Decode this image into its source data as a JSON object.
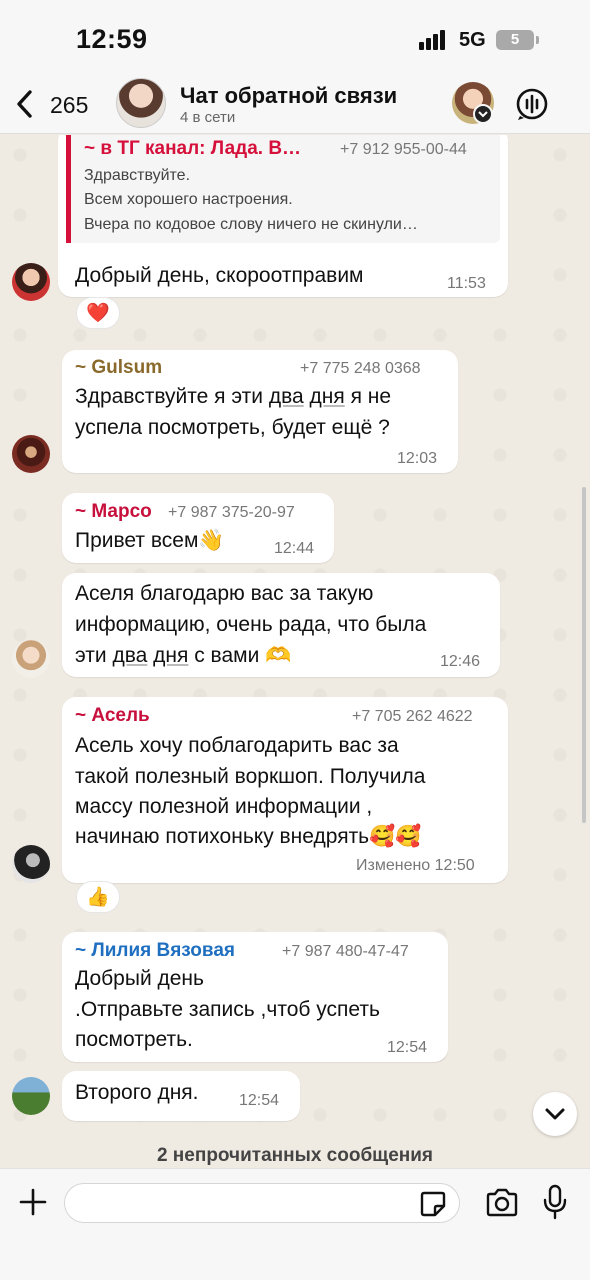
{
  "status": {
    "time": "12:59",
    "network": "5G",
    "battery": "5"
  },
  "header": {
    "back_count": "265",
    "title": "Чат обратной связи",
    "subtitle": "4 в сети"
  },
  "quote": {
    "name": "~ в ТГ канал: Лада. В…",
    "phone": "+7 912 955-00-44",
    "lines": [
      "Здравствуйте.",
      "Всем хорошего настроения.",
      "Вчера по кодовое слову ничего не скинули…"
    ]
  },
  "messages": [
    {
      "text": "Добрый день, скороотправим",
      "time": "11:53",
      "reaction": "❤️"
    },
    {
      "sender": "~ Gulsum",
      "phone": "+7 775 248 0368",
      "lines": [
        "Здравствуйте я эти два дня я не",
        "успела посмотреть, будет ещё ?"
      ],
      "time": "12:03"
    },
    {
      "sender": "~ Марсо",
      "phone": "+7 987 375-20-97",
      "text": "Привет всем👋",
      "time": "12:44"
    },
    {
      "lines": [
        "Аселя благодарю вас за такую",
        "информацию, очень рада, что была",
        "эти два дня с вами 🫶"
      ],
      "time": "12:46"
    },
    {
      "sender": "~ Асель",
      "phone": "+7 705 262 4622",
      "lines": [
        "Асель  хочу поблагодарить вас за",
        "такой полезный воркшоп. Получила",
        "массу полезной информации ,",
        "начинаю потихоньку внедрять🥰🥰"
      ],
      "time": "Изменено 12:50",
      "reaction": "👍"
    },
    {
      "sender": "~ Лилия Вязовая",
      "phone": "+7 987 480-47-47",
      "lines": [
        "Добрый день",
        ".Отправьте запись ,чтоб успеть",
        "посмотреть."
      ],
      "time": "12:54"
    },
    {
      "text": "Второго дня.",
      "time": "12:54"
    }
  ],
  "unread_label": "2 непрочитанных сообщения",
  "colors": {
    "quote_accent": "#d5103b",
    "gulsum": "#8a6a2c",
    "marso": "#c8103c",
    "asel": "#c8103c",
    "liliya": "#1f6fc1"
  },
  "icons": [
    "back-chevron-icon",
    "call-waveform-icon",
    "plus-icon",
    "sticker-icon",
    "camera-icon",
    "mic-icon",
    "chevron-down-icon"
  ]
}
